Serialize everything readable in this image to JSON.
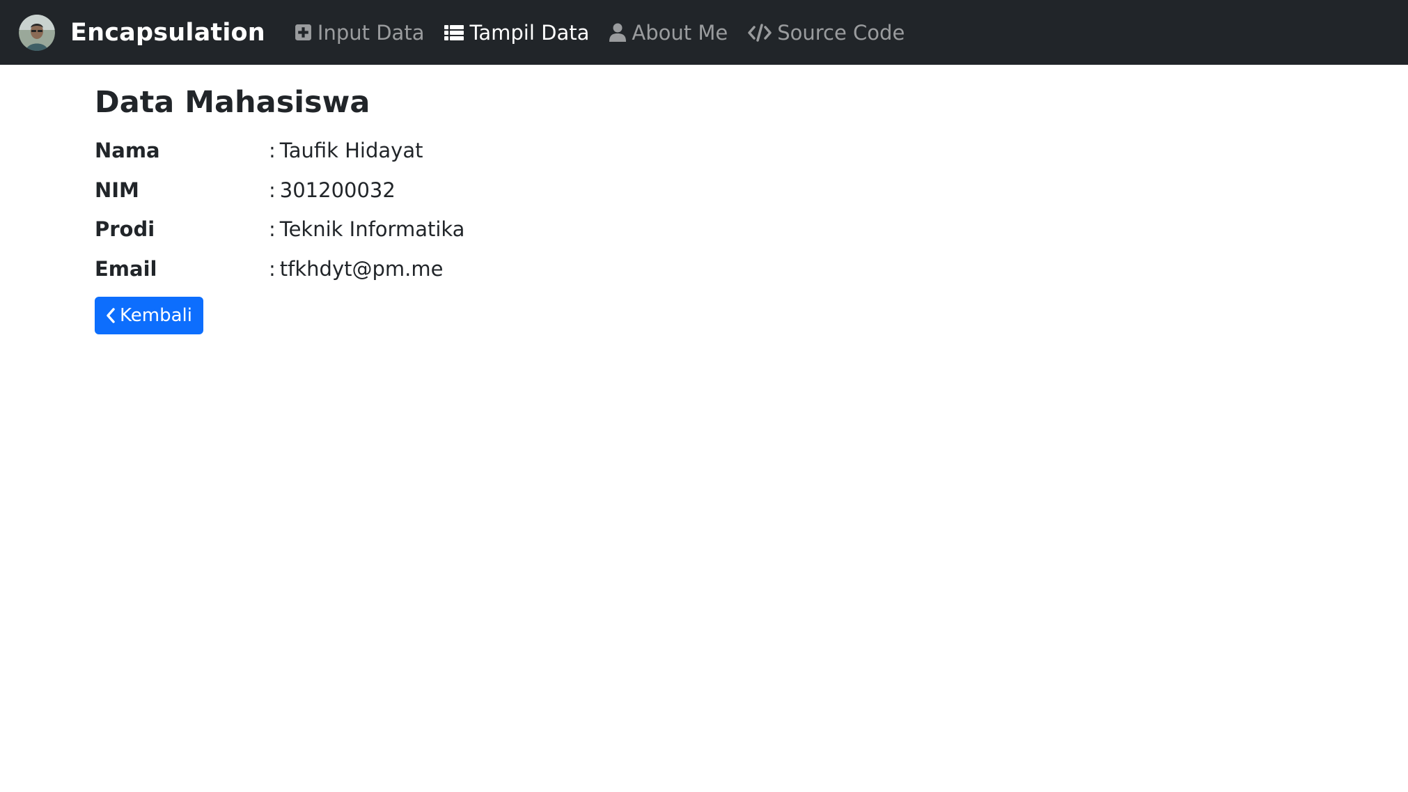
{
  "navbar": {
    "brand": "Encapsulation",
    "items": [
      {
        "label": "Input Data",
        "icon": "plus-square-icon",
        "active": false
      },
      {
        "label": "Tampil Data",
        "icon": "list-icon",
        "active": true
      },
      {
        "label": "About Me",
        "icon": "user-icon",
        "active": false
      },
      {
        "label": "Source Code",
        "icon": "code-icon",
        "active": false
      }
    ]
  },
  "main": {
    "title": "Data Mahasiswa",
    "fields": [
      {
        "label": "Nama",
        "value": "Taufik Hidayat"
      },
      {
        "label": "NIM",
        "value": "301200032"
      },
      {
        "label": "Prodi",
        "value": "Teknik Informatika"
      },
      {
        "label": "Email",
        "value": "tfkhdyt@pm.me"
      }
    ],
    "back_label": "Kembali"
  },
  "colors": {
    "navbar_bg": "#212529",
    "button_bg": "#0d6efd"
  }
}
